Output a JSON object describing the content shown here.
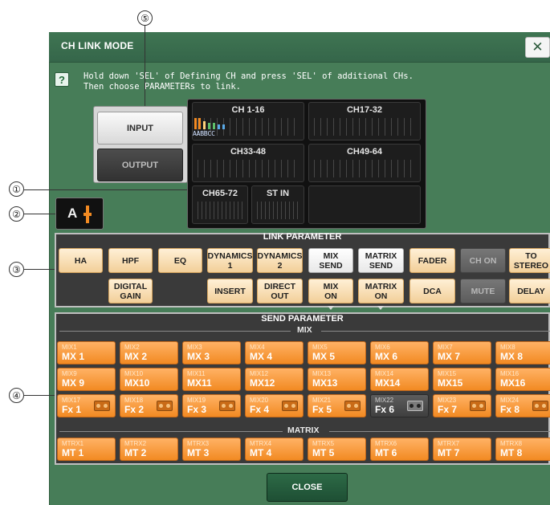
{
  "window": {
    "title": "CH LINK MODE",
    "close_glyph": "✕",
    "help_glyph": "?",
    "instruction_line1": "Hold down 'SEL' of Defining CH and press 'SEL' of additional CHs.",
    "instruction_line2": "Then choose PARAMETERs to link."
  },
  "callouts": [
    "⑤",
    "①",
    "②",
    "③",
    "④"
  ],
  "io": {
    "input": "INPUT",
    "output": "OUTPUT"
  },
  "channels": {
    "tiles": [
      "CH 1-16",
      "CH17-32",
      "CH33-48",
      "CH49-64",
      "CH65-72",
      "ST IN"
    ],
    "ch1_16_letters": "AABBCC"
  },
  "link_group": {
    "letter": "A"
  },
  "link_parameter": {
    "title": "LINK PARAMETER",
    "row1": [
      "HA",
      "HPF",
      "EQ",
      "DYNAMICS\n1",
      "DYNAMICS\n2",
      "MIX\nSEND",
      "MATRIX\nSEND",
      "FADER",
      "CH ON",
      "TO\nSTEREO"
    ],
    "row2": [
      "DIGITAL\nGAIN",
      "INSERT",
      "DIRECT\nOUT",
      "MIX\nON",
      "MATRIX\nON",
      "DCA",
      "MUTE",
      "DELAY"
    ]
  },
  "send_parameter": {
    "title": "SEND PARAMETER",
    "mix_label": "MIX",
    "matrix_label": "MATRIX",
    "mix_rows": [
      [
        {
          "small": "MIX1",
          "big": "MX 1"
        },
        {
          "small": "MIX2",
          "big": "MX 2"
        },
        {
          "small": "MIX3",
          "big": "MX 3"
        },
        {
          "small": "MIX4",
          "big": "MX 4"
        },
        {
          "small": "MIX5",
          "big": "MX 5"
        },
        {
          "small": "MIX6",
          "big": "MX 6"
        },
        {
          "small": "MIX7",
          "big": "MX 7"
        },
        {
          "small": "MIX8",
          "big": "MX 8"
        }
      ],
      [
        {
          "small": "MIX9",
          "big": "MX 9"
        },
        {
          "small": "MIX10",
          "big": "MX10"
        },
        {
          "small": "MIX11",
          "big": "MX11"
        },
        {
          "small": "MIX12",
          "big": "MX12"
        },
        {
          "small": "MIX13",
          "big": "MX13"
        },
        {
          "small": "MIX14",
          "big": "MX14"
        },
        {
          "small": "MIX15",
          "big": "MX15"
        },
        {
          "small": "MIX16",
          "big": "MX16"
        }
      ],
      [
        {
          "small": "MIX17",
          "big": "Fx 1"
        },
        {
          "small": "MIX18",
          "big": "Fx 2"
        },
        {
          "small": "MIX19",
          "big": "Fx 3"
        },
        {
          "small": "MIX20",
          "big": "Fx 4"
        },
        {
          "small": "MIX21",
          "big": "Fx 5"
        },
        {
          "small": "MIX22",
          "big": "Fx 6"
        },
        {
          "small": "MIX23",
          "big": "Fx 7"
        },
        {
          "small": "MIX24",
          "big": "Fx 8"
        }
      ]
    ],
    "matrix_row": [
      {
        "small": "MTRX1",
        "big": "MT 1"
      },
      {
        "small": "MTRX2",
        "big": "MT 2"
      },
      {
        "small": "MTRX3",
        "big": "MT 3"
      },
      {
        "small": "MTRX4",
        "big": "MT 4"
      },
      {
        "small": "MTRX5",
        "big": "MT 5"
      },
      {
        "small": "MTRX6",
        "big": "MT 6"
      },
      {
        "small": "MTRX7",
        "big": "MT 7"
      },
      {
        "small": "MTRX8",
        "big": "MT 8"
      }
    ]
  },
  "footer": {
    "close": "CLOSE"
  },
  "colors": {
    "window_green": "#477d58",
    "orange": "#f28a22",
    "cream": "#f2cf99"
  }
}
